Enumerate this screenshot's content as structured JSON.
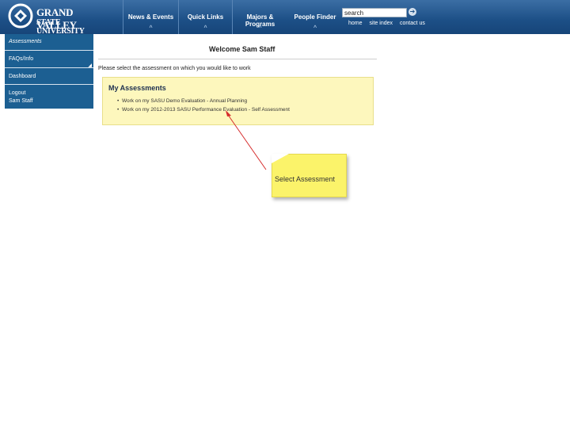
{
  "header": {
    "logo_line1": "GRAND VALLEY",
    "logo_line2": "STATE UNIVERSITY",
    "nav": [
      "News & Events",
      "Quick Links",
      "Majors & Programs",
      "People Finder"
    ],
    "search_value": "search",
    "util_links": [
      "home",
      "site index",
      "contact us"
    ],
    "colors": {
      "header_bg": "#1c4f86",
      "sidebar_bg": "#1c5f92"
    }
  },
  "sidebar": {
    "items": [
      "Assessments",
      "FAQs/Info",
      "Dashboard",
      "Logout",
      "Sam Staff"
    ]
  },
  "main": {
    "welcome": "Welcome Sam Staff",
    "instruction": "Please select the assessment on which you would like to work",
    "panel_title": "My Assessments",
    "assessments": [
      "Work on my SASU Demo Evaluation - Annual Planning",
      "Work on my 2012-2013 SASU Performance Evaluation - Self Assessment"
    ],
    "panel_color": "#fdf7bd"
  },
  "callout": {
    "text": "Select Assessment",
    "color": "#fbf36a",
    "arrow_color": "#d62b2b"
  }
}
